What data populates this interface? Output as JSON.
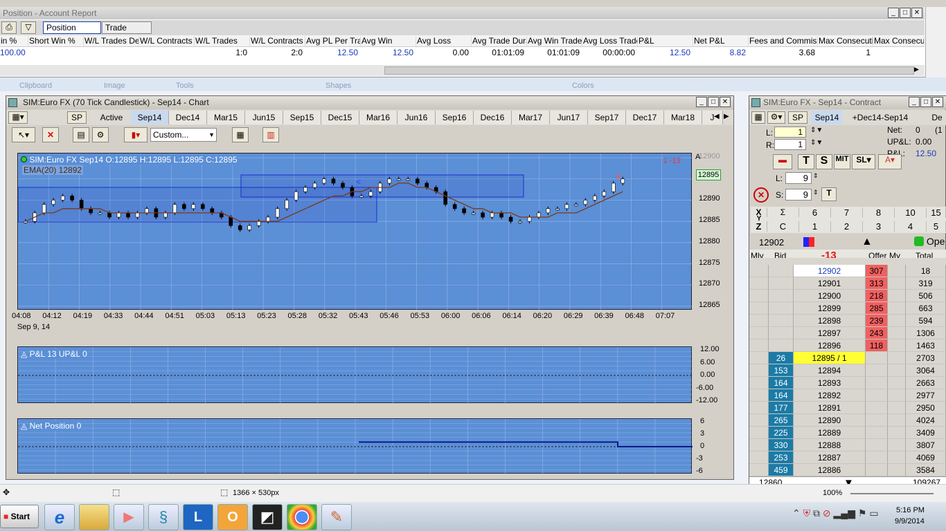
{
  "report": {
    "title": "Position - Account Report",
    "tabs": [
      "Position Report",
      "Trade Report"
    ],
    "headers": [
      "in %",
      "Short Win %",
      "W/L Trades Dec",
      "W/L Contracts D",
      "W/L Trades",
      "W/L Contracts",
      "Avg PL Per Trac",
      "Avg Win",
      "Avg Loss",
      "Avg Trade Dura",
      "Avg Win Trade I",
      "Avg Loss Trade",
      "P&L",
      "Net P&L",
      "Fees and Commissio",
      "Max Consecutiv",
      "Max Consecut"
    ],
    "values": [
      "100.00",
      "",
      "",
      "",
      "1:0",
      "2:0",
      "12.50",
      "12.50",
      "0.00",
      "01:01:09",
      "01:01:09",
      "00:00:00",
      "12.50",
      "8.82",
      "3.68",
      "1",
      ""
    ],
    "ribbon": [
      "Clipboard",
      "Image",
      "Tools",
      "Shapes",
      "Colors"
    ]
  },
  "chart": {
    "title": "SIM:Euro FX (70 Tick Candlestick) - Sep14 - Chart",
    "sp": "SP",
    "active": "Active",
    "tabs": [
      "Sep14",
      "Dec14",
      "Mar15",
      "Jun15",
      "Sep15",
      "Dec15",
      "Mar16",
      "Jun16",
      "Sep16",
      "Dec16",
      "Mar17",
      "Jun17",
      "Sep17",
      "Dec17",
      "Mar18",
      "J"
    ],
    "custom": "Custom...",
    "ohlc": "SIM:Euro FX Sep14 O:12895 H:12895 L:12895 C:12895",
    "ema": "EMA(20)  12892",
    "pos_flag": "-13",
    "price_tag": "12895",
    "corner": "A",
    "date_label": "Sep 9, 14",
    "pnl_label": "P&L  13  UP&L  0",
    "netpos_label": "Net Position  0"
  },
  "chart_data": [
    {
      "type": "candlestick",
      "name": "price",
      "x_labels": [
        "04:08",
        "04:12",
        "04:19",
        "04:33",
        "04:44",
        "04:51",
        "05:03",
        "05:13",
        "05:23",
        "05:28",
        "05:32",
        "05:43",
        "05:46",
        "05:53",
        "06:00",
        "06:06",
        "06:14",
        "06:20",
        "06:29",
        "06:39",
        "06:48",
        "07:07"
      ],
      "y_ticks": [
        12900,
        12895,
        12890,
        12885,
        12880,
        12875,
        12870,
        12865
      ],
      "ylim": [
        12864,
        12901
      ],
      "close": [
        12885,
        12887,
        12889,
        12890,
        12891,
        12890,
        12888,
        12887,
        12887,
        12886,
        12887,
        12886,
        12887,
        12888,
        12886,
        12887,
        12889,
        12888,
        12889,
        12888,
        12887,
        12886,
        12884,
        12883,
        12884,
        12885,
        12886,
        12888,
        12890,
        12892,
        12893,
        12894,
        12895,
        12894,
        12893,
        12891,
        12891,
        12892,
        12894,
        12895,
        12895,
        12895,
        12894,
        12893,
        12892,
        12889,
        12888,
        12887,
        12887,
        12886,
        12887,
        12886,
        12885,
        12885,
        12886,
        12887,
        12888,
        12888,
        12889,
        12889,
        12890,
        12891,
        12892,
        12894,
        12895
      ],
      "ema": [
        12885,
        12886,
        12887,
        12887,
        12888,
        12888,
        12888,
        12888,
        12888,
        12887,
        12887,
        12887,
        12887,
        12887,
        12887,
        12887,
        12887,
        12887,
        12887,
        12887,
        12887,
        12887,
        12886,
        12885,
        12885,
        12885,
        12885,
        12885,
        12886,
        12887,
        12888,
        12889,
        12890,
        12891,
        12891,
        12892,
        12892,
        12893,
        12893,
        12893,
        12894,
        12894,
        12893,
        12893,
        12892,
        12891,
        12890,
        12889,
        12888,
        12888,
        12887,
        12887,
        12887,
        12886,
        12886,
        12886,
        12886,
        12887,
        12887,
        12887,
        12888,
        12889,
        12890,
        12891,
        12892
      ]
    },
    {
      "type": "line",
      "name": "P&L",
      "y_ticks": [
        "12.00",
        "6.00",
        "0.00",
        "-6.00",
        "-12.00"
      ],
      "ylim": [
        -12,
        12
      ],
      "values": [
        0,
        12.5
      ]
    },
    {
      "type": "line",
      "name": "Net Position",
      "y_ticks": [
        "6",
        "3",
        "0",
        "-3",
        "-6"
      ],
      "ylim": [
        -6,
        6
      ],
      "values": [
        0,
        1,
        0
      ]
    }
  ],
  "dom": {
    "title": "SIM:Euro FX - Sep14 - Contract",
    "sp": "SP",
    "tab1": "Sep14",
    "tab2": "+Dec14-Sep14",
    "tab3": "De",
    "l_label": "L:",
    "l_val": "1",
    "r_label": "R:",
    "r_val": "1",
    "net_label": "Net:",
    "net_val": "0",
    "upl_label": "UP&L:",
    "upl_val": "0.00",
    "pl_label": "P&L:",
    "pl_val": "12.50",
    "extra": "(1",
    "l2_label": "L:",
    "l2_val": "9",
    "s_label": "S:",
    "s_val": "9",
    "grid_top": [
      "X",
      "Σ",
      "6",
      "7",
      "8",
      "10",
      "15"
    ],
    "grid_mid": "Y",
    "grid_bot": [
      "Z",
      "C",
      "1",
      "2",
      "3",
      "4",
      "5"
    ],
    "top_price": "12902",
    "open_label": "Ope",
    "headers": [
      "Mly B",
      "Bid",
      "-13",
      "Offer",
      "My C",
      "Total"
    ],
    "rows": [
      [
        "",
        "",
        "12902",
        "307",
        "",
        "18"
      ],
      [
        "",
        "",
        "12901",
        "313",
        "",
        "319"
      ],
      [
        "",
        "",
        "12900",
        "218",
        "",
        "506"
      ],
      [
        "",
        "",
        "12899",
        "285",
        "",
        "663"
      ],
      [
        "",
        "",
        "12898",
        "239",
        "",
        "594"
      ],
      [
        "",
        "",
        "12897",
        "243",
        "",
        "1306"
      ],
      [
        "",
        "",
        "12896",
        "118",
        "",
        "1463"
      ],
      [
        "",
        "26",
        "12895 / 1",
        "",
        "",
        "2703"
      ],
      [
        "",
        "153",
        "12894",
        "",
        "",
        "3064"
      ],
      [
        "",
        "164",
        "12893",
        "",
        "",
        "2663"
      ],
      [
        "",
        "164",
        "12892",
        "",
        "",
        "2977"
      ],
      [
        "",
        "177",
        "12891",
        "",
        "",
        "2950"
      ],
      [
        "",
        "265",
        "12890",
        "",
        "",
        "4024"
      ],
      [
        "",
        "225",
        "12889",
        "",
        "",
        "3409"
      ],
      [
        "",
        "330",
        "12888",
        "",
        "",
        "3807"
      ],
      [
        "",
        "253",
        "12887",
        "",
        "",
        "4069"
      ],
      [
        "",
        "459",
        "12886",
        "",
        "",
        "3584"
      ]
    ],
    "bottom_left": "12860",
    "bottom_right": "109267"
  },
  "status": {
    "size": "1366 × 530px",
    "zoom": "100%"
  },
  "taskbar": {
    "start": "Start",
    "time": "5:16 PM",
    "date": "9/9/2014"
  },
  "colors": {
    "chart_bg": "#5b8fd6",
    "offer": "#f06060",
    "bid": "#1b7ba6",
    "current": "#ffff33"
  }
}
